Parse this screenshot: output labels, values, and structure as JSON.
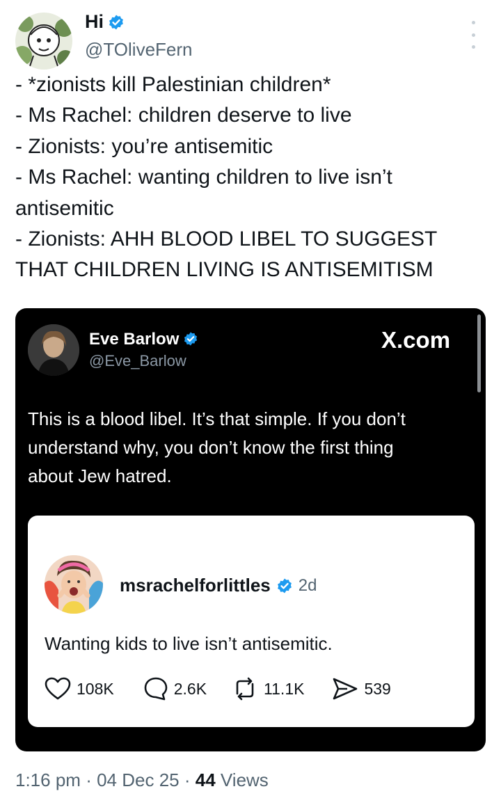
{
  "tweet": {
    "author": {
      "name": "Hi",
      "handle": "@TOliveFern",
      "verified": true
    },
    "text_lines": [
      "- *zionists kill Palestinian children*",
      "- Ms Rachel: children deserve to live",
      "- Zionists: you’re antisemitic",
      "- Ms Rachel: wanting children to live isn’t",
      "antisemitic",
      "- Zionists: AHH BLOOD LIBEL TO SUGGEST",
      "THAT CHILDREN LIVING IS ANTISEMITISM"
    ],
    "footer": {
      "time": "1:16 pm",
      "separator": "·",
      "date": "04 Dec 25",
      "views_count": "44",
      "views_label": "Views"
    }
  },
  "embedded": {
    "author": {
      "name": "Eve Barlow",
      "handle": "@Eve_Barlow",
      "verified": true
    },
    "site_label": "X.com",
    "text_lines": [
      "This is a blood libel. It’s that simple. If you don’t",
      "understand why, you don’t know the first thing",
      "about Jew hatred."
    ],
    "quoted": {
      "author": "msrachelforlittles",
      "verified": true,
      "age": "2d",
      "text": "Wanting kids to live isn’t antisemitic.",
      "stats": {
        "likes": "108K",
        "comments": "2.6K",
        "reposts": "11.1K",
        "shares": "539"
      }
    }
  },
  "colors": {
    "verified_blue": "#1d9bf0",
    "secondary_text": "#536471",
    "embed_background": "#000000"
  },
  "icons": [
    "verified-badge-icon",
    "more-options-icon",
    "heart-icon",
    "comment-icon",
    "repost-icon",
    "share-icon"
  ]
}
